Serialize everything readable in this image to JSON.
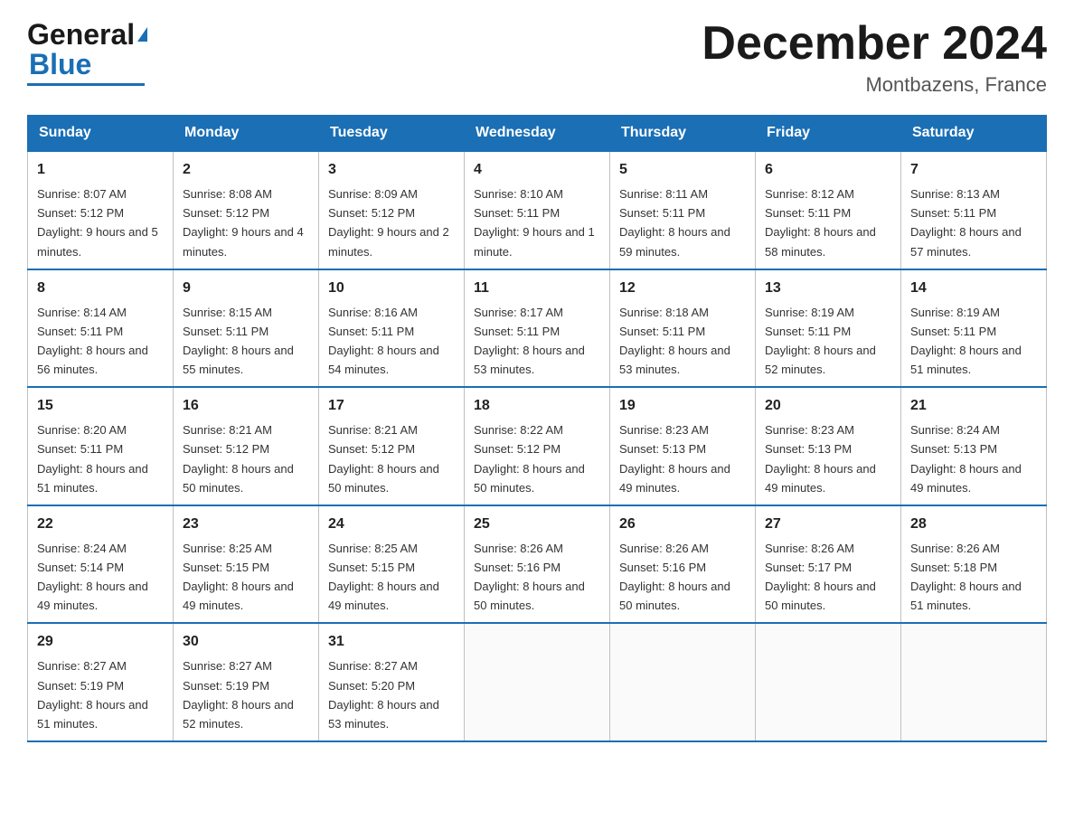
{
  "header": {
    "logo_general": "General",
    "logo_blue": "Blue",
    "month_title": "December 2024",
    "location": "Montbazens, France"
  },
  "days_of_week": [
    "Sunday",
    "Monday",
    "Tuesday",
    "Wednesday",
    "Thursday",
    "Friday",
    "Saturday"
  ],
  "weeks": [
    [
      {
        "day": "1",
        "sunrise": "8:07 AM",
        "sunset": "5:12 PM",
        "daylight": "9 hours and 5 minutes."
      },
      {
        "day": "2",
        "sunrise": "8:08 AM",
        "sunset": "5:12 PM",
        "daylight": "9 hours and 4 minutes."
      },
      {
        "day": "3",
        "sunrise": "8:09 AM",
        "sunset": "5:12 PM",
        "daylight": "9 hours and 2 minutes."
      },
      {
        "day": "4",
        "sunrise": "8:10 AM",
        "sunset": "5:11 PM",
        "daylight": "9 hours and 1 minute."
      },
      {
        "day": "5",
        "sunrise": "8:11 AM",
        "sunset": "5:11 PM",
        "daylight": "8 hours and 59 minutes."
      },
      {
        "day": "6",
        "sunrise": "8:12 AM",
        "sunset": "5:11 PM",
        "daylight": "8 hours and 58 minutes."
      },
      {
        "day": "7",
        "sunrise": "8:13 AM",
        "sunset": "5:11 PM",
        "daylight": "8 hours and 57 minutes."
      }
    ],
    [
      {
        "day": "8",
        "sunrise": "8:14 AM",
        "sunset": "5:11 PM",
        "daylight": "8 hours and 56 minutes."
      },
      {
        "day": "9",
        "sunrise": "8:15 AM",
        "sunset": "5:11 PM",
        "daylight": "8 hours and 55 minutes."
      },
      {
        "day": "10",
        "sunrise": "8:16 AM",
        "sunset": "5:11 PM",
        "daylight": "8 hours and 54 minutes."
      },
      {
        "day": "11",
        "sunrise": "8:17 AM",
        "sunset": "5:11 PM",
        "daylight": "8 hours and 53 minutes."
      },
      {
        "day": "12",
        "sunrise": "8:18 AM",
        "sunset": "5:11 PM",
        "daylight": "8 hours and 53 minutes."
      },
      {
        "day": "13",
        "sunrise": "8:19 AM",
        "sunset": "5:11 PM",
        "daylight": "8 hours and 52 minutes."
      },
      {
        "day": "14",
        "sunrise": "8:19 AM",
        "sunset": "5:11 PM",
        "daylight": "8 hours and 51 minutes."
      }
    ],
    [
      {
        "day": "15",
        "sunrise": "8:20 AM",
        "sunset": "5:11 PM",
        "daylight": "8 hours and 51 minutes."
      },
      {
        "day": "16",
        "sunrise": "8:21 AM",
        "sunset": "5:12 PM",
        "daylight": "8 hours and 50 minutes."
      },
      {
        "day": "17",
        "sunrise": "8:21 AM",
        "sunset": "5:12 PM",
        "daylight": "8 hours and 50 minutes."
      },
      {
        "day": "18",
        "sunrise": "8:22 AM",
        "sunset": "5:12 PM",
        "daylight": "8 hours and 50 minutes."
      },
      {
        "day": "19",
        "sunrise": "8:23 AM",
        "sunset": "5:13 PM",
        "daylight": "8 hours and 49 minutes."
      },
      {
        "day": "20",
        "sunrise": "8:23 AM",
        "sunset": "5:13 PM",
        "daylight": "8 hours and 49 minutes."
      },
      {
        "day": "21",
        "sunrise": "8:24 AM",
        "sunset": "5:13 PM",
        "daylight": "8 hours and 49 minutes."
      }
    ],
    [
      {
        "day": "22",
        "sunrise": "8:24 AM",
        "sunset": "5:14 PM",
        "daylight": "8 hours and 49 minutes."
      },
      {
        "day": "23",
        "sunrise": "8:25 AM",
        "sunset": "5:15 PM",
        "daylight": "8 hours and 49 minutes."
      },
      {
        "day": "24",
        "sunrise": "8:25 AM",
        "sunset": "5:15 PM",
        "daylight": "8 hours and 49 minutes."
      },
      {
        "day": "25",
        "sunrise": "8:26 AM",
        "sunset": "5:16 PM",
        "daylight": "8 hours and 50 minutes."
      },
      {
        "day": "26",
        "sunrise": "8:26 AM",
        "sunset": "5:16 PM",
        "daylight": "8 hours and 50 minutes."
      },
      {
        "day": "27",
        "sunrise": "8:26 AM",
        "sunset": "5:17 PM",
        "daylight": "8 hours and 50 minutes."
      },
      {
        "day": "28",
        "sunrise": "8:26 AM",
        "sunset": "5:18 PM",
        "daylight": "8 hours and 51 minutes."
      }
    ],
    [
      {
        "day": "29",
        "sunrise": "8:27 AM",
        "sunset": "5:19 PM",
        "daylight": "8 hours and 51 minutes."
      },
      {
        "day": "30",
        "sunrise": "8:27 AM",
        "sunset": "5:19 PM",
        "daylight": "8 hours and 52 minutes."
      },
      {
        "day": "31",
        "sunrise": "8:27 AM",
        "sunset": "5:20 PM",
        "daylight": "8 hours and 53 minutes."
      },
      null,
      null,
      null,
      null
    ]
  ]
}
